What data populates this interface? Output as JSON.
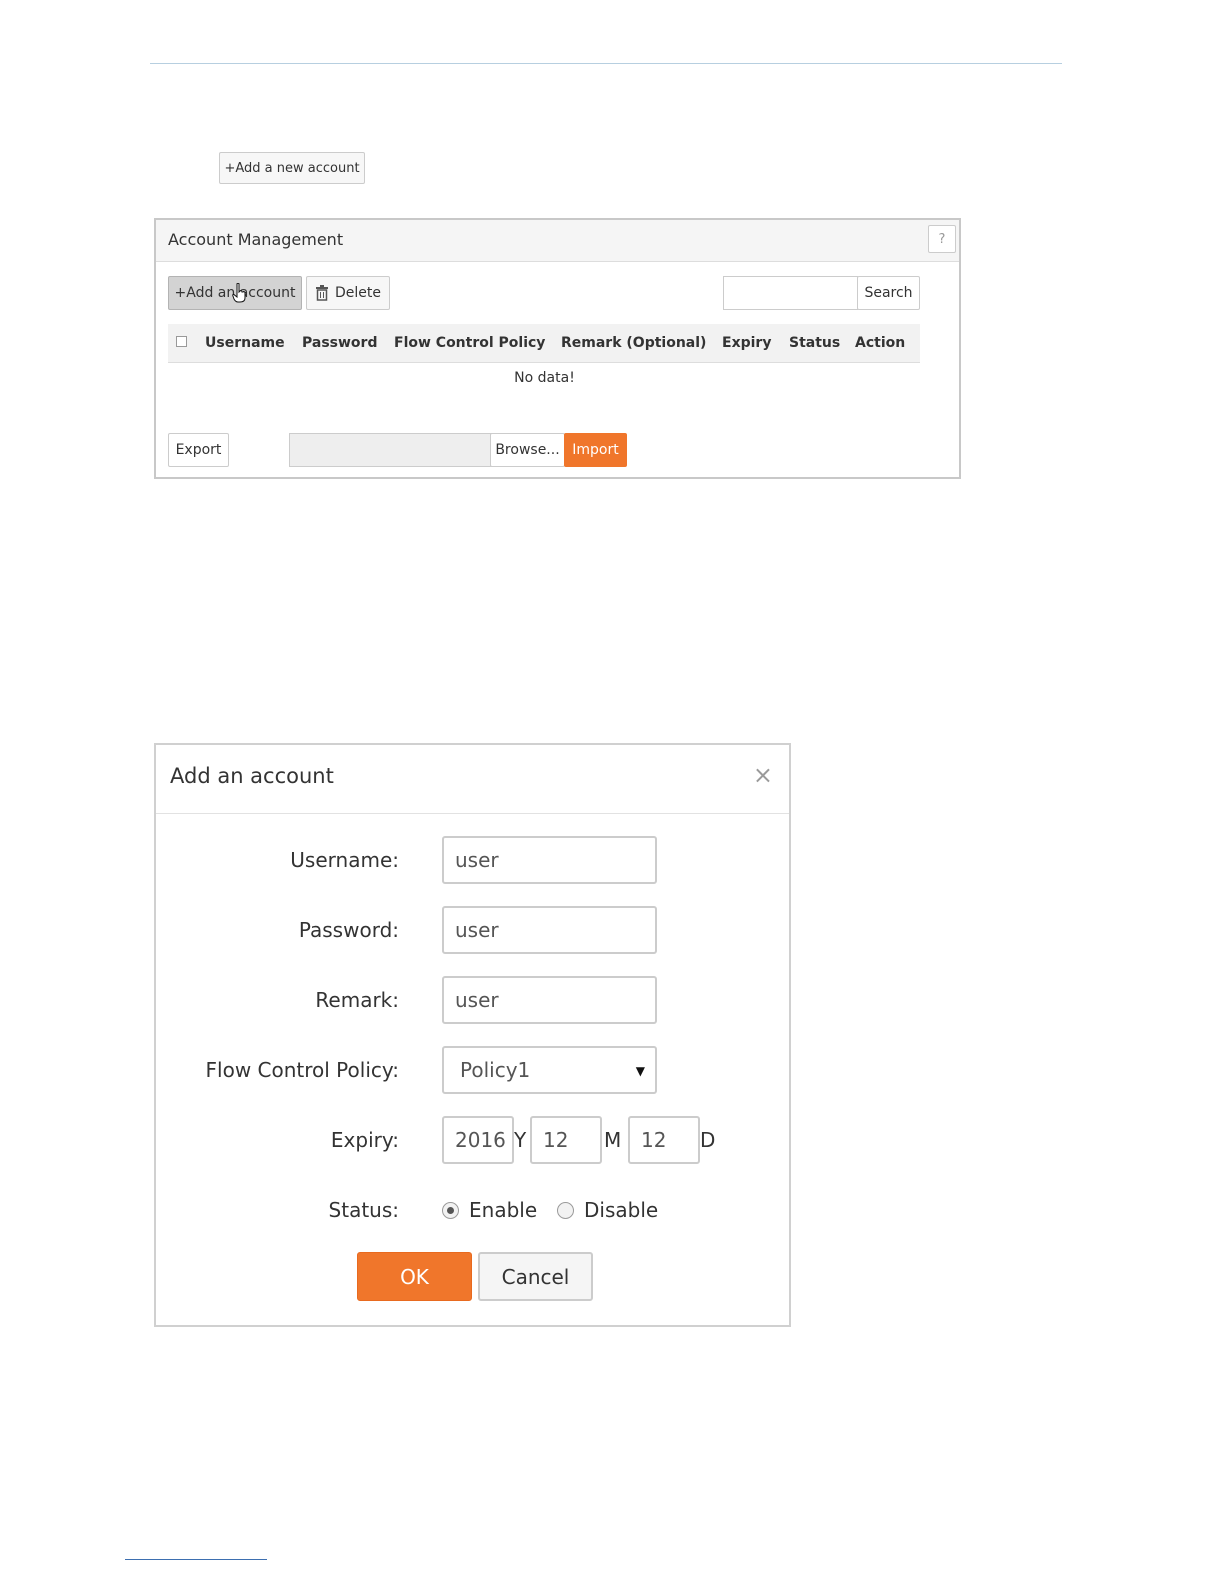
{
  "top_button": {
    "label": "+Add a new account"
  },
  "panel": {
    "title": "Account Management",
    "help_label": "?",
    "toolbar": {
      "add_label": "+Add an account",
      "delete_label": "Delete",
      "search_value": "",
      "search_label": "Search"
    },
    "columns": [
      "Username",
      "Password",
      "Flow Control Policy",
      "Remark (Optional)",
      "Expiry",
      "Status",
      "Action"
    ],
    "empty_text": "No data!",
    "footer": {
      "export_label": "Export",
      "file_value": "",
      "browse_label": "Browse...",
      "import_label": "Import"
    }
  },
  "dialog": {
    "title": "Add an account",
    "close_glyph": "×",
    "fields": {
      "username_label": "Username:",
      "username_value": "user",
      "password_label": "Password:",
      "password_value": "user",
      "remark_label": "Remark:",
      "remark_value": "user",
      "policy_label": "Flow Control Policy:",
      "policy_value": "Policy1",
      "expiry_label": "Expiry:",
      "expiry_year": "2016",
      "expiry_year_unit": "Y",
      "expiry_month": "12",
      "expiry_month_unit": "M",
      "expiry_day": "12",
      "expiry_day_unit": "D",
      "status_label": "Status:",
      "status_enable": "Enable",
      "status_disable": "Disable",
      "status_selected": "Enable"
    },
    "ok_label": "OK",
    "cancel_label": "Cancel"
  },
  "colors": {
    "accent": "#f0762b",
    "rule": "#b7cfe0",
    "link_rule": "#3d6fb0"
  },
  "icons": {
    "delete": "trash-icon",
    "cursor": "hand-pointer-icon",
    "close": "close-icon",
    "select": "caret-down-icon"
  }
}
